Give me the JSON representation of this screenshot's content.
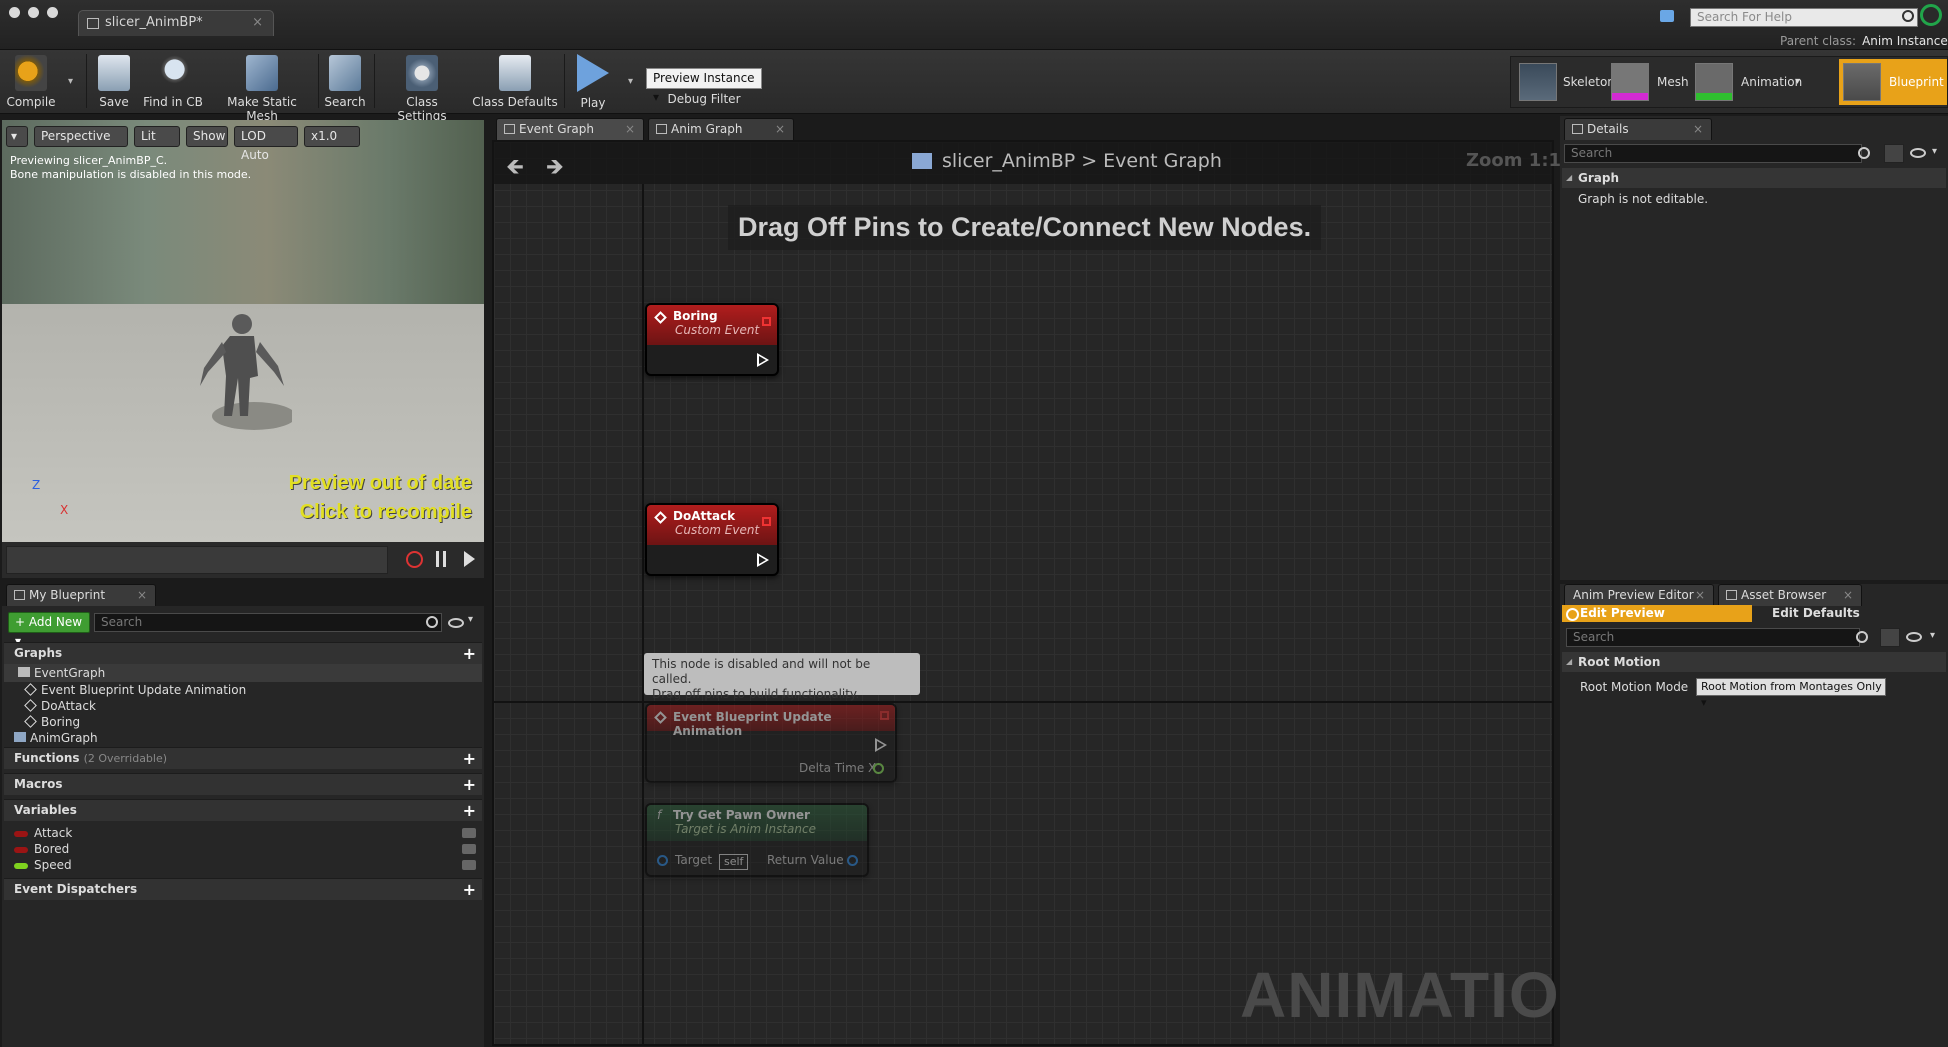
{
  "window": {
    "title": "slicer_AnimBP*"
  },
  "help": {
    "placeholder": "Search For Help"
  },
  "parent_class": {
    "label": "Parent class:",
    "value": "Anim Instance"
  },
  "toolbar": {
    "compile": "Compile",
    "save": "Save",
    "find_in_cb": "Find in CB",
    "make_static_mesh": "Make Static Mesh",
    "search": "Search",
    "class_settings": "Class Settings",
    "class_defaults": "Class Defaults",
    "play": "Play",
    "preview_instance": "Preview Instance",
    "debug_filter": "Debug Filter"
  },
  "modes": [
    {
      "label": "Skeleton"
    },
    {
      "label": "Mesh"
    },
    {
      "label": "Animation"
    },
    {
      "label": "Blueprint"
    }
  ],
  "viewport": {
    "perspective": "Perspective",
    "lit": "Lit",
    "show": "Show",
    "lod": "LOD Auto",
    "speed": "x1.0",
    "preview_line1": "Previewing slicer_AnimBP_C.",
    "preview_line2": "Bone manipulation is disabled in this mode.",
    "warning_line1": "Preview out of date",
    "warning_line2": "Click to recompile",
    "axis_z": "Z",
    "axis_x": "X"
  },
  "my_blueprint": {
    "tab": "My Blueprint",
    "add_new": "Add New",
    "search_placeholder": "Search",
    "sections": {
      "graphs": "Graphs",
      "functions": "Functions",
      "functions_sub": "(2 Overridable)",
      "macros": "Macros",
      "variables": "Variables",
      "event_dispatchers": "Event Dispatchers"
    },
    "graph_items": {
      "event_graph": "EventGraph",
      "update_anim": "Event Blueprint Update Animation",
      "do_attack": "DoAttack",
      "boring": "Boring",
      "anim_graph": "AnimGraph"
    },
    "variables": [
      {
        "name": "Attack",
        "color": "#9b1414"
      },
      {
        "name": "Bored",
        "color": "#9b1414"
      },
      {
        "name": "Speed",
        "color": "#7fd11f"
      }
    ]
  },
  "graph_tabs": {
    "event_graph": "Event Graph",
    "anim_graph": "Anim Graph"
  },
  "graph": {
    "breadcrumb_root": "slicer_AnimBP",
    "breadcrumb_sep": ">",
    "breadcrumb_leaf": "Event Graph",
    "zoom": "Zoom 1:1",
    "hint": "Drag Off Pins to Create/Connect New Nodes.",
    "watermark": "ANIMATION",
    "nodes": {
      "boring": {
        "title": "Boring",
        "subtitle": "Custom Event"
      },
      "do_attack": {
        "title": "DoAttack",
        "subtitle": "Custom Event"
      },
      "update_anim": {
        "title": "Event Blueprint Update Animation",
        "pin": "Delta Time X"
      },
      "try_get_pawn": {
        "title": "Try Get Pawn Owner",
        "subtitle": "Target is Anim Instance",
        "target": "Target",
        "self": "self",
        "return": "Return Value"
      }
    },
    "disabled_comment_line1": "This node is disabled and will not be called.",
    "disabled_comment_line2": "Drag off pins to build functionality."
  },
  "details": {
    "tab": "Details",
    "search_placeholder": "Search",
    "graph_category": "Graph",
    "not_editable": "Graph is not editable."
  },
  "anim_preview": {
    "tab": "Anim Preview Editor",
    "asset_tab": "Asset Browser",
    "edit_preview": "Edit Preview",
    "edit_defaults": "Edit Defaults",
    "search_placeholder": "Search",
    "root_motion_category": "Root Motion",
    "root_motion_mode_label": "Root Motion Mode",
    "root_motion_mode_value": "Root Motion from Montages Only"
  },
  "colors": {
    "accent": "#e8a219",
    "event_node": "#b11d1d",
    "add_new": "#3f9d32"
  }
}
